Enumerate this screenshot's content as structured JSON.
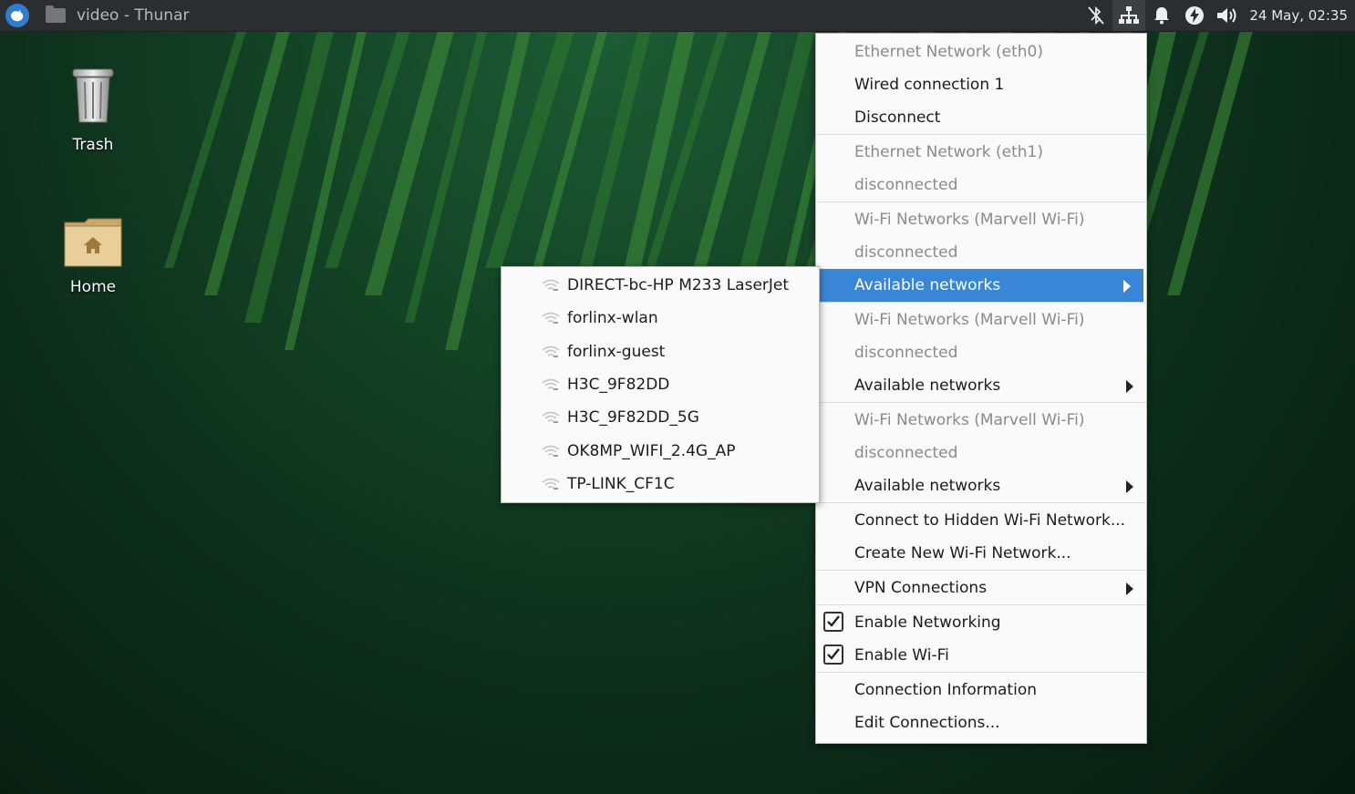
{
  "taskbar": {
    "window_title": "video - Thunar",
    "clock": "24 May, 02:35",
    "icons": [
      "xfce-menu-icon",
      "folder-icon",
      "bluetooth-off-icon",
      "network-icon",
      "notification-bell-icon",
      "power-icon",
      "volume-icon"
    ]
  },
  "desktop": {
    "icons": [
      {
        "label": "Trash",
        "icon": "trash-icon"
      },
      {
        "label": "Home",
        "icon": "home-folder-icon"
      }
    ]
  },
  "network_menu": {
    "items": [
      {
        "label": "Ethernet Network (eth0)",
        "style": "header"
      },
      {
        "label": "Wired connection 1",
        "style": "normal"
      },
      {
        "label": "Disconnect",
        "style": "normal"
      },
      {
        "label": "Ethernet Network (eth1)",
        "style": "header"
      },
      {
        "label": "disconnected",
        "style": "header"
      },
      {
        "label": "Wi-Fi Networks (Marvell Wi-Fi)",
        "style": "header"
      },
      {
        "label": "disconnected",
        "style": "header"
      },
      {
        "label": "Available networks",
        "style": "submenu-highlighted"
      },
      {
        "label": "Wi-Fi Networks (Marvell Wi-Fi)",
        "style": "header"
      },
      {
        "label": "disconnected",
        "style": "header"
      },
      {
        "label": "Available networks",
        "style": "submenu"
      },
      {
        "label": "Wi-Fi Networks (Marvell Wi-Fi)",
        "style": "header"
      },
      {
        "label": "disconnected",
        "style": "header"
      },
      {
        "label": "Available networks",
        "style": "submenu"
      },
      {
        "label": "Connect to Hidden Wi-Fi Network...",
        "style": "normal"
      },
      {
        "label": "Create New Wi-Fi Network...",
        "style": "normal"
      },
      {
        "label": "VPN Connections",
        "style": "submenu"
      },
      {
        "label": "Enable Networking",
        "style": "checked"
      },
      {
        "label": "Enable Wi-Fi",
        "style": "checked"
      },
      {
        "label": "Connection Information",
        "style": "normal"
      },
      {
        "label": "Edit Connections...",
        "style": "normal"
      }
    ]
  },
  "available_networks": [
    "DIRECT-bc-HP M233 LaserJet",
    "forlinx-wlan",
    "forlinx-guest",
    "H3C_9F82DD",
    "H3C_9F82DD_5G",
    "OK8MP_WIFI_2.4G_AP",
    "TP-LINK_CF1C"
  ],
  "colors": {
    "highlight": "#3a86d6",
    "taskbar": "#2b2e30",
    "menu_bg": "#fafafa",
    "dim_text": "#8a8a8a"
  }
}
